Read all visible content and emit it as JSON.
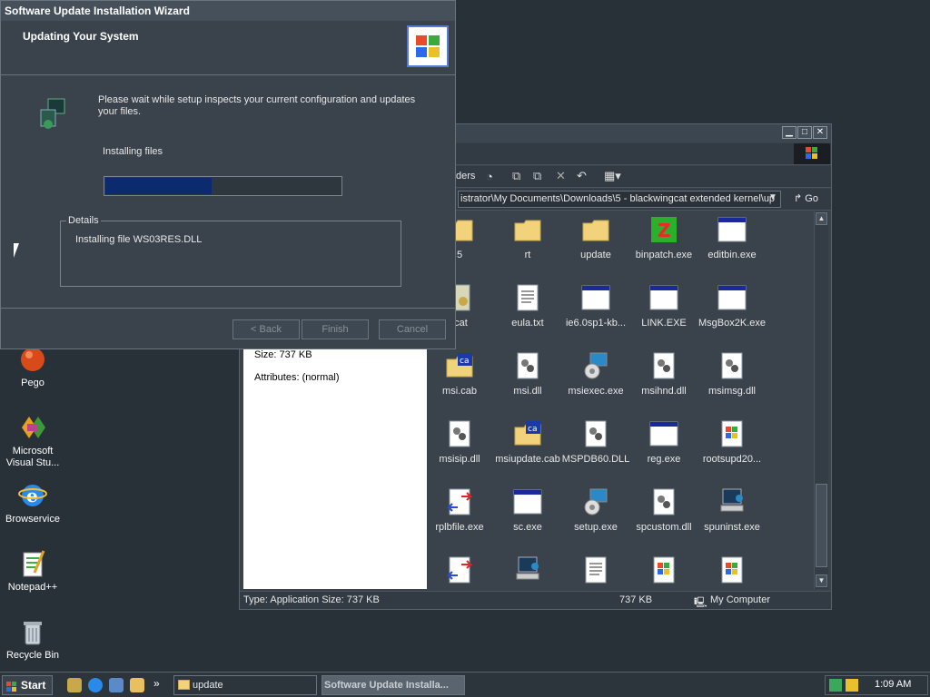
{
  "desktop": {
    "icons": [
      {
        "label": "Pego",
        "icon": "pego-icon"
      },
      {
        "label": "Microsoft Visual Stu...",
        "icon": "visual-studio-icon"
      },
      {
        "label": "Browservice",
        "icon": "browser-icon"
      },
      {
        "label": "Notepad++",
        "icon": "notepadpp-icon"
      },
      {
        "label": "Recycle Bin",
        "icon": "recycle-bin-icon"
      }
    ]
  },
  "explorer": {
    "toolbar": {
      "folders_label": "ders"
    },
    "address": "istrator\\My Documents\\Downloads\\5 - blackwingcat extended kernel\\up",
    "go_label": "Go",
    "details": {
      "size": "Size: 737 KB",
      "attributes": "Attributes: (normal)"
    },
    "files": [
      {
        "label": "5",
        "type": "folder"
      },
      {
        "label": "rt",
        "type": "folder"
      },
      {
        "label": "update",
        "type": "folder"
      },
      {
        "label": "binpatch.exe",
        "type": "binpatch"
      },
      {
        "label": "editbin.exe",
        "type": "app"
      },
      {
        "label": ".cat",
        "type": "cert"
      },
      {
        "label": "eula.txt",
        "type": "text"
      },
      {
        "label": "ie6.0sp1-kb...",
        "type": "app"
      },
      {
        "label": "LINK.EXE",
        "type": "app"
      },
      {
        "label": "MsgBox2K.exe",
        "type": "app"
      },
      {
        "label": "msi.cab",
        "type": "cab"
      },
      {
        "label": "msi.dll",
        "type": "dll"
      },
      {
        "label": "msiexec.exe",
        "type": "installer"
      },
      {
        "label": "msihnd.dll",
        "type": "dll"
      },
      {
        "label": "msimsg.dll",
        "type": "dll"
      },
      {
        "label": "msisip.dll",
        "type": "dll"
      },
      {
        "label": "msiupdate.cab",
        "type": "cab"
      },
      {
        "label": "MSPDB60.DLL",
        "type": "dll"
      },
      {
        "label": "reg.exe",
        "type": "app"
      },
      {
        "label": "rootsupd20...",
        "type": "winlogo"
      },
      {
        "label": "rplbfile.exe",
        "type": "bin"
      },
      {
        "label": "sc.exe",
        "type": "app"
      },
      {
        "label": "setup.exe",
        "type": "installer"
      },
      {
        "label": "spcustom.dll",
        "type": "dll"
      },
      {
        "label": "spuninst.exe",
        "type": "computer"
      },
      {
        "label": "",
        "type": "bin"
      },
      {
        "label": "",
        "type": "computer"
      },
      {
        "label": "",
        "type": "text"
      },
      {
        "label": "",
        "type": "winlogo"
      },
      {
        "label": "",
        "type": "winlogo"
      }
    ],
    "status": {
      "left": "Type: Application Size: 737 KB",
      "size": "737 KB",
      "zone": "My Computer"
    }
  },
  "wizard": {
    "title": "Software Update Installation Wizard",
    "header": "Updating Your System",
    "message": "Please wait while setup inspects your current configuration and updates your files.",
    "installing_label": "Installing files",
    "progress": 0.45,
    "details_legend": "Details",
    "details_text": "Installing file WS03RES.DLL",
    "buttons": {
      "back": "< Back",
      "finish": "Finish",
      "cancel": "Cancel"
    }
  },
  "taskbar": {
    "start": "Start",
    "tasks": [
      {
        "label": "update"
      },
      {
        "label": "Software Update Installa..."
      }
    ],
    "clock": "1:09 AM",
    "overflow": "»"
  },
  "colors": {
    "progress_fill": "#0c2a6e",
    "desktop": "#283038"
  }
}
